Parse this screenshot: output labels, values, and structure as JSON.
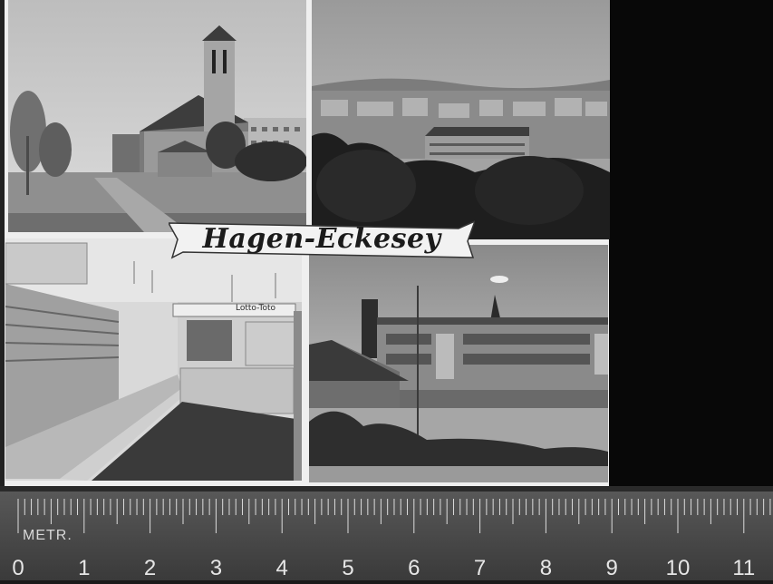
{
  "banner": {
    "title": "Hagen-Eckesey"
  },
  "shop": {
    "sign": "Lotto-Toto"
  },
  "ruler": {
    "label": "METR.",
    "numbers": [
      "0",
      "1",
      "2",
      "3",
      "4",
      "5",
      "6",
      "7",
      "8",
      "9",
      "10",
      "11"
    ]
  }
}
